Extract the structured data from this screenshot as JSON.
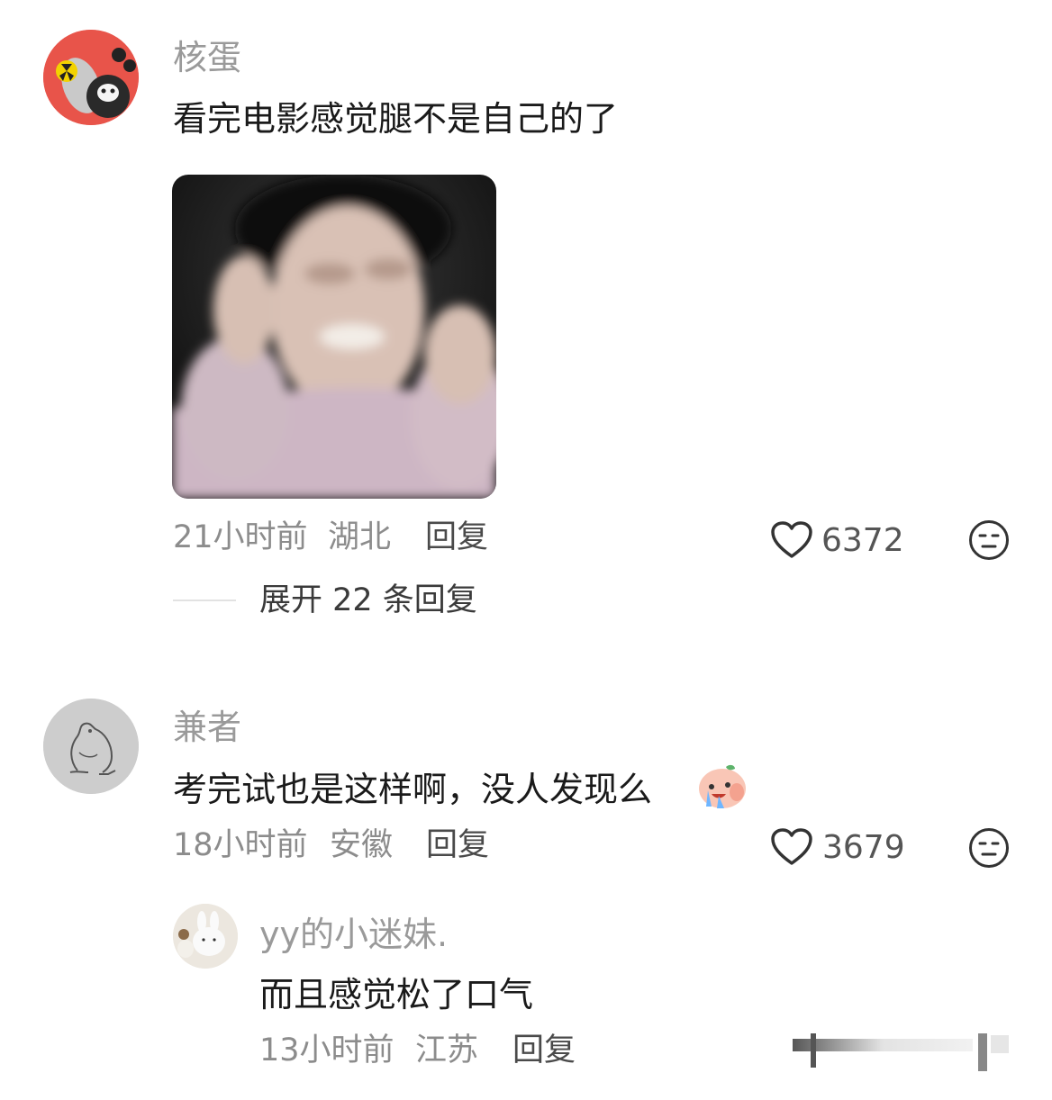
{
  "comments": [
    {
      "username": "核蛋",
      "avatar_icon": "nuclear-cat-avatar",
      "text": "看完电影感觉腿不是自己的了",
      "sticker_icon": "blurry-person-meme-image",
      "time": "21小时前",
      "location": "湖北",
      "reply_label": "回复",
      "likes": "6372",
      "expand_label": "展开 22 条回复"
    },
    {
      "username": "兼者",
      "avatar_icon": "frog-sketch-avatar",
      "text": "考完试也是这样啊，没人发现么",
      "emoji_icon": "crying-peach-emoji",
      "time": "18小时前",
      "location": "安徽",
      "reply_label": "回复",
      "likes": "3679",
      "replies": [
        {
          "username": "yy的小迷妹.",
          "avatar_icon": "plush-bunny-avatar",
          "text": "而且感觉松了口气",
          "time": "13小时前",
          "location": "江苏",
          "reply_label": "回复"
        }
      ]
    }
  ],
  "colors": {
    "username": "#9a9a9a",
    "meta": "#8c8c8c",
    "text": "#1a1a1a"
  }
}
